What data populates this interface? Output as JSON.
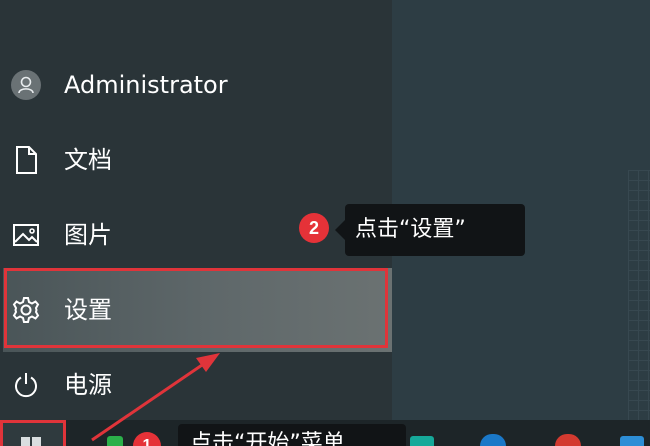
{
  "start_menu": {
    "user_name": "Administrator",
    "documents_label": "文档",
    "pictures_label": "图片",
    "settings_label": "设置",
    "power_label": "电源"
  },
  "annotations": {
    "step2_number": "2",
    "step2_text": "点击“设置”",
    "step1_number": "1",
    "step1_text": "点击“开始”菜单"
  },
  "icons": {
    "user": "avatar-icon",
    "documents": "document-icon",
    "pictures": "image-icon",
    "settings": "gear-icon",
    "power": "power-icon",
    "start": "windows-logo-icon"
  },
  "colors": {
    "highlight": "#e0343a",
    "badge": "#e53238",
    "callout_bg": "#111416",
    "panel_bg": "#2a3438",
    "selected_item_bg": "#5f686a"
  }
}
